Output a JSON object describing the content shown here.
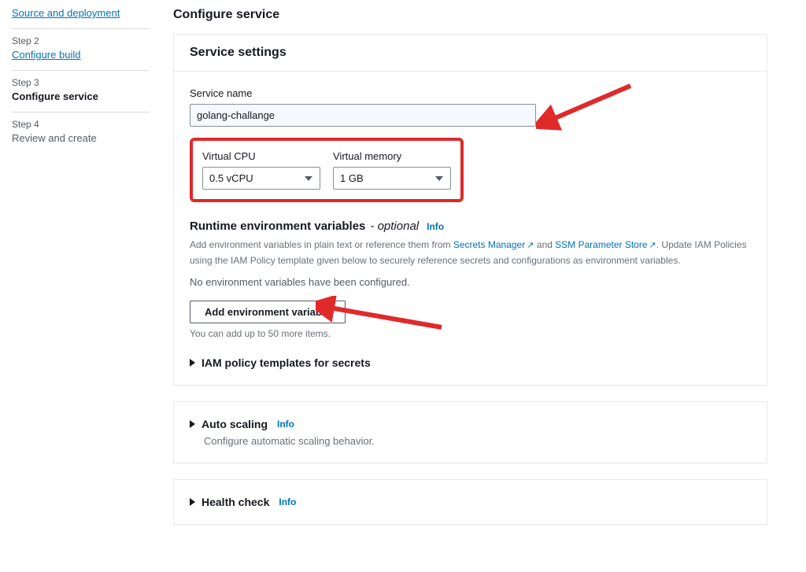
{
  "steps": [
    {
      "num": "",
      "label": "Source and deployment",
      "state": "link"
    },
    {
      "num": "Step 2",
      "label": "Configure build",
      "state": "link"
    },
    {
      "num": "Step 3",
      "label": "Configure service",
      "state": "active"
    },
    {
      "num": "Step 4",
      "label": "Review and create",
      "state": "disabled"
    }
  ],
  "page": {
    "heading": "Configure service"
  },
  "settings": {
    "panel_title": "Service settings",
    "service_name_label": "Service name",
    "service_name_value": "golang-challange",
    "vcpu_label": "Virtual CPU",
    "vcpu_value": "0.5 vCPU",
    "vmem_label": "Virtual memory",
    "vmem_value": "1 GB"
  },
  "envvars": {
    "title": "Runtime environment variables",
    "optional": "- optional",
    "info": "Info",
    "help_pre": "Add environment variables in plain text or reference them from ",
    "link1": "Secrets Manager",
    "help_mid": " and ",
    "link2": "SSM Parameter Store",
    "help_post": ". Update IAM Policies using the IAM Policy template given below to securely reference secrets and configurations as environment variables.",
    "empty": "No environment variables have been configured.",
    "add_btn": "Add environment variable",
    "limit": "You can add up to 50 more items."
  },
  "iam": {
    "title": "IAM policy templates for secrets"
  },
  "autoscaling": {
    "title": "Auto scaling",
    "info": "Info",
    "sub": "Configure automatic scaling behavior."
  },
  "healthcheck": {
    "title": "Health check",
    "info": "Info"
  }
}
